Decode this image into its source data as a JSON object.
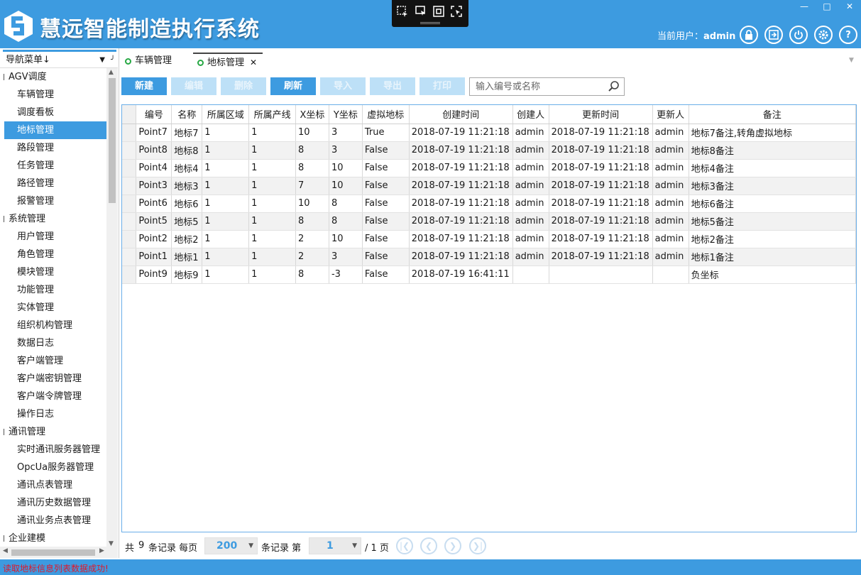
{
  "app": {
    "title": "慧远智能制造执行系统",
    "user_label": "当前用户：",
    "user_name": "admin"
  },
  "colors": {
    "accent": "#3d9be0",
    "tab_dot": "#27a844",
    "status_text": "#e0182a"
  },
  "sidebar": {
    "header": "导航菜单",
    "tree": [
      {
        "type": "group",
        "label": "AGV调度"
      },
      {
        "type": "item",
        "label": "车辆管理"
      },
      {
        "type": "item",
        "label": "调度看板"
      },
      {
        "type": "item",
        "label": "地标管理",
        "selected": true
      },
      {
        "type": "item",
        "label": "路段管理"
      },
      {
        "type": "item",
        "label": "任务管理"
      },
      {
        "type": "item",
        "label": "路径管理"
      },
      {
        "type": "item",
        "label": "报警管理"
      },
      {
        "type": "group",
        "label": "系统管理"
      },
      {
        "type": "item",
        "label": "用户管理"
      },
      {
        "type": "item",
        "label": "角色管理"
      },
      {
        "type": "item",
        "label": "模块管理"
      },
      {
        "type": "item",
        "label": "功能管理"
      },
      {
        "type": "item",
        "label": "实体管理"
      },
      {
        "type": "item",
        "label": "组织机构管理"
      },
      {
        "type": "item",
        "label": "数据日志"
      },
      {
        "type": "item",
        "label": "客户端管理"
      },
      {
        "type": "item",
        "label": "客户端密钥管理"
      },
      {
        "type": "item",
        "label": "客户端令牌管理"
      },
      {
        "type": "item",
        "label": "操作日志"
      },
      {
        "type": "group",
        "label": "通讯管理"
      },
      {
        "type": "item",
        "label": "实时通讯服务器管理"
      },
      {
        "type": "item",
        "label": "OpcUa服务器管理"
      },
      {
        "type": "item",
        "label": "通讯点表管理"
      },
      {
        "type": "item",
        "label": "通讯历史数据管理"
      },
      {
        "type": "item",
        "label": "通讯业务点表管理"
      },
      {
        "type": "group",
        "label": "企业建模"
      }
    ]
  },
  "tabs": [
    {
      "label": "车辆管理",
      "active": false
    },
    {
      "label": "地标管理",
      "active": true
    }
  ],
  "toolbar": {
    "buttons": [
      {
        "label": "新建",
        "enabled": true
      },
      {
        "label": "编辑",
        "enabled": false
      },
      {
        "label": "删除",
        "enabled": false
      },
      {
        "label": "刷新",
        "enabled": true
      },
      {
        "label": "导入",
        "enabled": false
      },
      {
        "label": "导出",
        "enabled": false
      },
      {
        "label": "打印",
        "enabled": false
      }
    ],
    "search_placeholder": "输入编号或名称"
  },
  "table": {
    "columns": [
      "编号",
      "名称",
      "所属区域",
      "所属产线",
      "X坐标",
      "Y坐标",
      "虚拟地标",
      "创建时间",
      "创建人",
      "更新时间",
      "更新人",
      "备注"
    ],
    "rows": [
      [
        "Point7",
        "地标7",
        "1",
        "1",
        "10",
        "3",
        "True",
        "2018-07-19 11:21:18",
        "admin",
        "2018-07-19 11:21:18",
        "admin",
        "地标7备注,转角虚拟地标"
      ],
      [
        "Point8",
        "地标8",
        "1",
        "1",
        "8",
        "3",
        "False",
        "2018-07-19 11:21:18",
        "admin",
        "2018-07-19 11:21:18",
        "admin",
        "地标8备注"
      ],
      [
        "Point4",
        "地标4",
        "1",
        "1",
        "8",
        "10",
        "False",
        "2018-07-19 11:21:18",
        "admin",
        "2018-07-19 11:21:18",
        "admin",
        "地标4备注"
      ],
      [
        "Point3",
        "地标3",
        "1",
        "1",
        "7",
        "10",
        "False",
        "2018-07-19 11:21:18",
        "admin",
        "2018-07-19 11:21:18",
        "admin",
        "地标3备注"
      ],
      [
        "Point6",
        "地标6",
        "1",
        "1",
        "10",
        "8",
        "False",
        "2018-07-19 11:21:18",
        "admin",
        "2018-07-19 11:21:18",
        "admin",
        "地标6备注"
      ],
      [
        "Point5",
        "地标5",
        "1",
        "1",
        "8",
        "8",
        "False",
        "2018-07-19 11:21:18",
        "admin",
        "2018-07-19 11:21:18",
        "admin",
        "地标5备注"
      ],
      [
        "Point2",
        "地标2",
        "1",
        "1",
        "2",
        "10",
        "False",
        "2018-07-19 11:21:18",
        "admin",
        "2018-07-19 11:21:18",
        "admin",
        "地标2备注"
      ],
      [
        "Point1",
        "地标1",
        "1",
        "1",
        "2",
        "3",
        "False",
        "2018-07-19 11:21:18",
        "admin",
        "2018-07-19 11:21:18",
        "admin",
        "地标1备注"
      ],
      [
        "Point9",
        "地标9",
        "1",
        "1",
        "8",
        "-3",
        "False",
        "2018-07-19 16:41:11",
        "",
        "",
        "",
        "负坐标"
      ]
    ]
  },
  "pager": {
    "total_prefix": "共",
    "total": "9",
    "total_suffix": "条记录 每页",
    "page_size": "200",
    "page_prefix": "条记录 第",
    "page": "1",
    "page_suffix": "/ 1 页"
  },
  "status": {
    "message": "读取地标信息列表数据成功!"
  }
}
